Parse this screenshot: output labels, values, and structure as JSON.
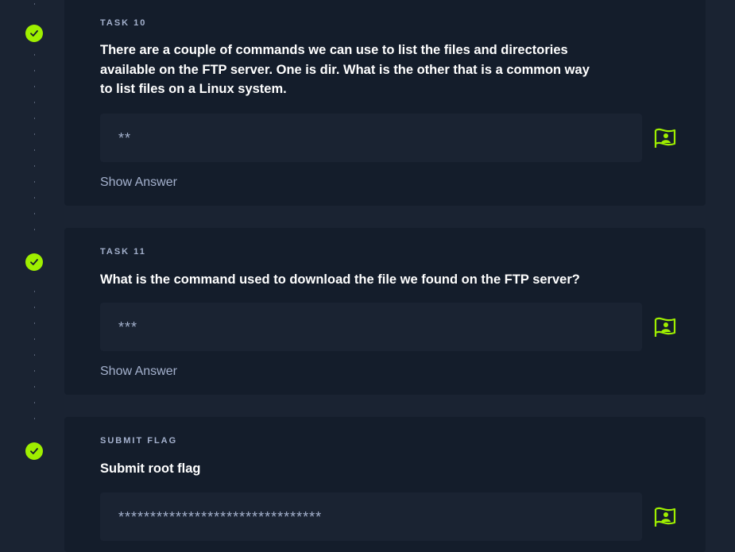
{
  "tasks": [
    {
      "label": "TASK 10",
      "question": "There are a couple of commands we can use to list the files and directories available on the FTP server. One is dir. What is the other that is a common way to list files on a Linux system.",
      "answer": "**",
      "show_answer": "Show Answer"
    },
    {
      "label": "TASK 11",
      "question": "What is the command used to download the file we found on the FTP server?",
      "answer": "***",
      "show_answer": "Show Answer"
    },
    {
      "label": "SUBMIT FLAG",
      "question": "Submit root flag",
      "answer": "********************************"
    }
  ],
  "colors": {
    "background": "#1a2332",
    "card": "#141d2b",
    "accent": "#9fef00",
    "muted_text": "#a4b1cd",
    "text": "#ffffff"
  },
  "icons": [
    "check-icon",
    "flag-icon"
  ]
}
